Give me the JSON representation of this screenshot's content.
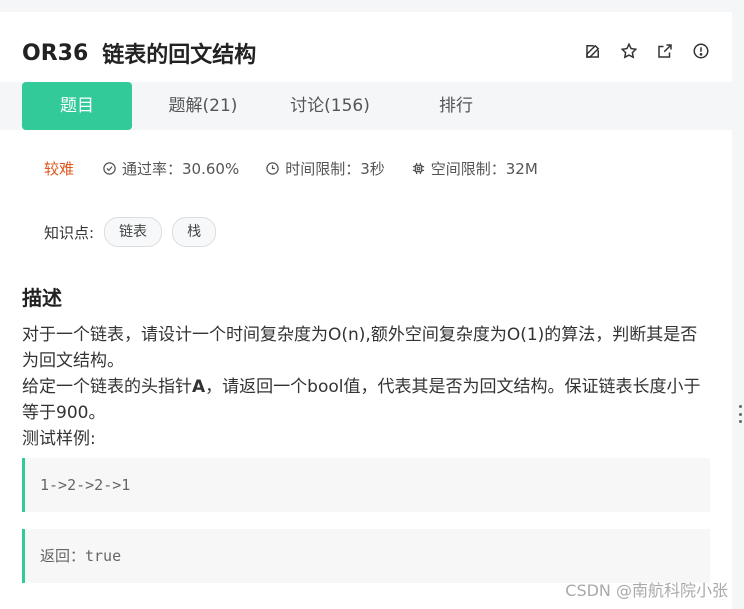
{
  "header": {
    "code": "OR36",
    "title": "链表的回文结构",
    "icons": [
      "edit-icon",
      "star-icon",
      "share-icon",
      "info-icon"
    ]
  },
  "tabs": [
    {
      "label": "题目",
      "active": true
    },
    {
      "label": "题解(21)",
      "active": false
    },
    {
      "label": "讨论(156)",
      "active": false
    },
    {
      "label": "排行",
      "active": false
    }
  ],
  "meta": {
    "difficulty": "较难",
    "pass_rate": "通过率：30.60%",
    "time_limit": "时间限制：3秒",
    "space_limit": "空间限制：32M"
  },
  "knowledge": {
    "label": "知识点:",
    "tags": [
      "链表",
      "栈"
    ]
  },
  "description": {
    "heading": "描述",
    "line1": "对于一个链表，请设计一个时间复杂度为O(n),额外空间复杂度为O(1)的算法，判断其是否为回文结构。",
    "line2_prefix": "给定一个链表的头指针",
    "line2_bold": "A",
    "line2_suffix": "，请返回一个bool值，代表其是否为回文结构。保证链表长度小于等于900。",
    "line3": "测试样例:"
  },
  "examples": {
    "input": "1->2->2->1",
    "output": "返回：true"
  },
  "watermark": "CSDN @南航科院小张",
  "colors": {
    "accent": "#32ca99",
    "difficulty": "#e0571e"
  }
}
